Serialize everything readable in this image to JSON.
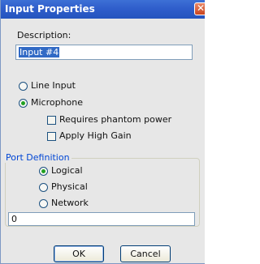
{
  "window": {
    "title": "Input Properties",
    "close_glyph": "✕"
  },
  "description": {
    "label": "Description:",
    "value": "Input #4"
  },
  "input_type": {
    "line_input": {
      "label": "Line Input",
      "checked": false
    },
    "microphone": {
      "label": "Microphone",
      "checked": true
    },
    "phantom_power": {
      "label": "Requires phantom power",
      "checked": false
    },
    "high_gain": {
      "label": "Apply High Gain",
      "checked": false
    }
  },
  "port_definition": {
    "title": "Port Definition",
    "logical": {
      "label": "Logical",
      "checked": true
    },
    "physical": {
      "label": "Physical",
      "checked": false
    },
    "network": {
      "label": "Network",
      "checked": false
    },
    "port_value": "0"
  },
  "buttons": {
    "ok": "OK",
    "cancel": "Cancel"
  }
}
